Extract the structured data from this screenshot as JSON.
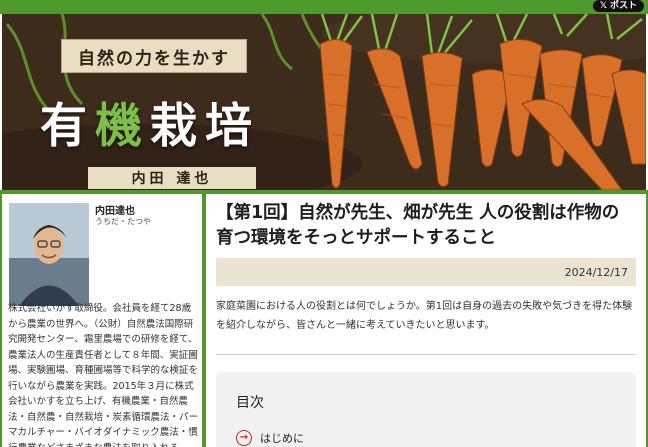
{
  "share": {
    "post_label": "ポスト",
    "x_glyph": "𝕏"
  },
  "banner": {
    "subtitle": "自然の力を生かす",
    "title_part1": "有",
    "title_part2": "機",
    "title_part3": "栽培",
    "author": "内田 達也"
  },
  "sidebar": {
    "author_name": "内田達也",
    "author_reading": "うちだ・たつや",
    "bio": "株式会社いかす取締役。会社員を経て28歳から農業の世界へ。（公財）自然農法国際研究開発センター、霜里農場での研修を経て、農業法人の生産責任者として８年間、実証圃場、実験圃場、育種圃場等で科学的な検証を行いながら農業を実践。2015年３月に株式会社いかすを立ち上げ、有機農業・自然農法・自然農・自然栽培・炭素循環農法・パーマカルチャー・バイオダイナミック農法・慣行農業などさまざまな農法を取り入れる"
  },
  "article": {
    "title": "【第1回】自然が先生、畑が先生 人の役割は作物の育つ環境をそっとサポートすること",
    "date": "2024/12/17",
    "lead": "家庭菜園における人の役割とは何でしょうか。第1回は自身の過去の失敗や気づきを得た体験を紹介しながら、皆さんと一緒に考えていきたいと思います。"
  },
  "toc": {
    "heading": "目次",
    "items": [
      {
        "label": "はじめに"
      }
    ]
  },
  "colors": {
    "accent_green": "#4e9b2b",
    "date_bar": "#ece4d3",
    "toc_arrow": "#c62828"
  }
}
